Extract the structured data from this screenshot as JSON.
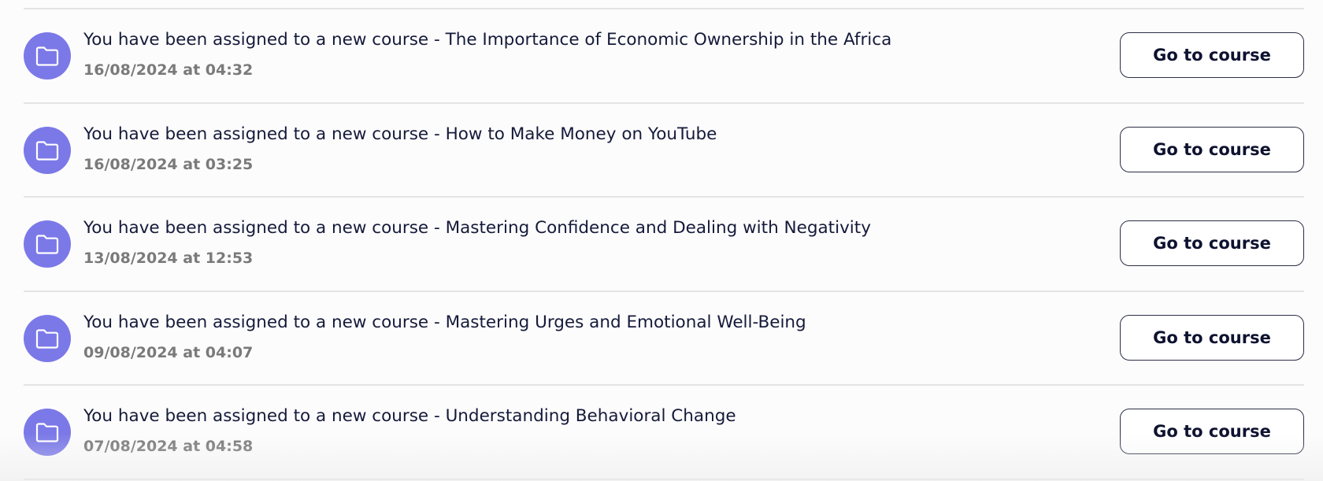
{
  "notifications": [
    {
      "icon": "folder-icon",
      "title": "You have been assigned to a new course - The Importance of Economic Ownership in the Africa",
      "timestamp": "16/08/2024 at 04:32",
      "button_label": "Go to course"
    },
    {
      "icon": "folder-icon",
      "title": "You have been assigned to a new course - How to Make Money on YouTube",
      "timestamp": "16/08/2024 at 03:25",
      "button_label": "Go to course"
    },
    {
      "icon": "folder-icon",
      "title": "You have been assigned to a new course - Mastering Confidence and Dealing with Negativity",
      "timestamp": "13/08/2024 at 12:53",
      "button_label": "Go to course"
    },
    {
      "icon": "folder-icon",
      "title": "You have been assigned to a new course - Mastering Urges and Emotional Well-Being",
      "timestamp": "09/08/2024 at 04:07",
      "button_label": "Go to course"
    },
    {
      "icon": "folder-icon",
      "title": "You have been assigned to a new course - Understanding Behavioral Change",
      "timestamp": "07/08/2024 at 04:58",
      "button_label": "Go to course"
    }
  ],
  "colors": {
    "icon_background": "#7b79e8",
    "title_text": "#141a3a",
    "timestamp_text": "#7a7a7a",
    "button_border": "#2b2f45",
    "divider": "#e4e4e6",
    "page_background": "#fdfcfc"
  }
}
